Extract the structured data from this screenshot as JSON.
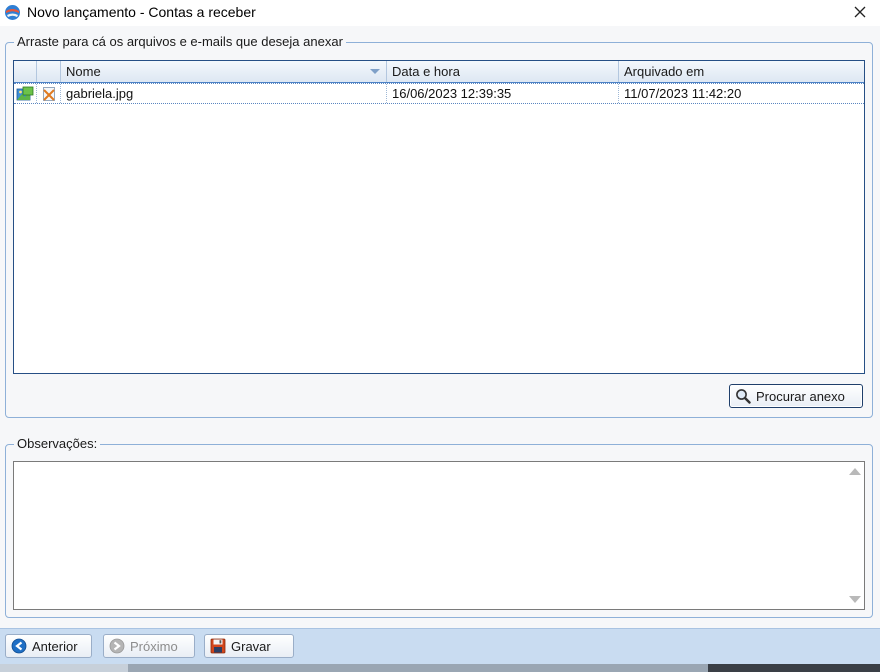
{
  "window": {
    "title": "Novo lançamento - Contas a receber",
    "app_icon": "app-globe-icon",
    "close_icon": "close-icon"
  },
  "attachments": {
    "group_label": "Arraste para cá os arquivos e e-mails que deseja anexar",
    "columns": [
      "Nome",
      "Data e hora",
      "Arquivado em"
    ],
    "sorted_column": "Nome",
    "sort_direction": "descending",
    "rows": [
      {
        "type_icon": "image-file-icon",
        "action_icon": "remove-attachment-icon",
        "nome": "gabriela.jpg",
        "data_hora": "16/06/2023 12:39:35",
        "arquivado_em": "11/07/2023 11:42:20"
      }
    ],
    "browse_button": {
      "label": "Procurar anexo",
      "icon": "magnifier-icon"
    }
  },
  "observations": {
    "group_label": "Observações:",
    "value": ""
  },
  "footer": {
    "prev_button": {
      "label": "Anterior",
      "icon": "back-arrow-icon",
      "enabled": true
    },
    "next_button": {
      "label": "Próximo",
      "icon": "forward-arrow-icon",
      "enabled": false
    },
    "save_button": {
      "label": "Gravar",
      "icon": "floppy-disk-icon",
      "enabled": true
    }
  },
  "colors": {
    "accent": "#4c82c6",
    "footer_bar": "#c9dcf1",
    "group_border": "#8eb0d8"
  }
}
